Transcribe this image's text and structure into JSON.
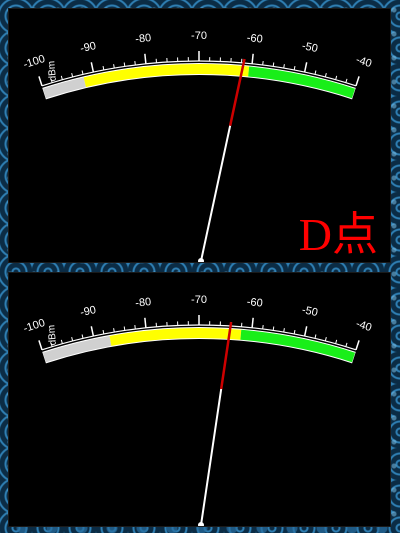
{
  "meters": [
    {
      "unit": "dBm",
      "scale_min": -100,
      "scale_max": -40,
      "tick_labels": [
        "-100",
        "-90",
        "-80",
        "-70",
        "-60",
        "-50",
        "-40"
      ],
      "needle_value": -61.5,
      "caption": "D点",
      "zones": [
        {
          "from": -100,
          "to": -92,
          "color": "#d0d0d0"
        },
        {
          "from": -92,
          "to": -60.5,
          "color": "#ffff00"
        },
        {
          "from": -60.5,
          "to": -40,
          "color": "#19ee19"
        }
      ],
      "needle_color": "#ffffff",
      "needle_tip_color": "#cc0000"
    },
    {
      "unit": "dBm",
      "scale_min": -100,
      "scale_max": -40,
      "tick_labels": [
        "-100",
        "-90",
        "-80",
        "-70",
        "-60",
        "-50",
        "-40"
      ],
      "needle_value": -64,
      "caption": "",
      "zones": [
        {
          "from": -100,
          "to": -87,
          "color": "#d0d0d0"
        },
        {
          "from": -87,
          "to": -62,
          "color": "#ffff00"
        },
        {
          "from": -62,
          "to": -40,
          "color": "#19ee19"
        }
      ],
      "needle_color": "#ffffff",
      "needle_tip_color": "#cc0000"
    }
  ]
}
